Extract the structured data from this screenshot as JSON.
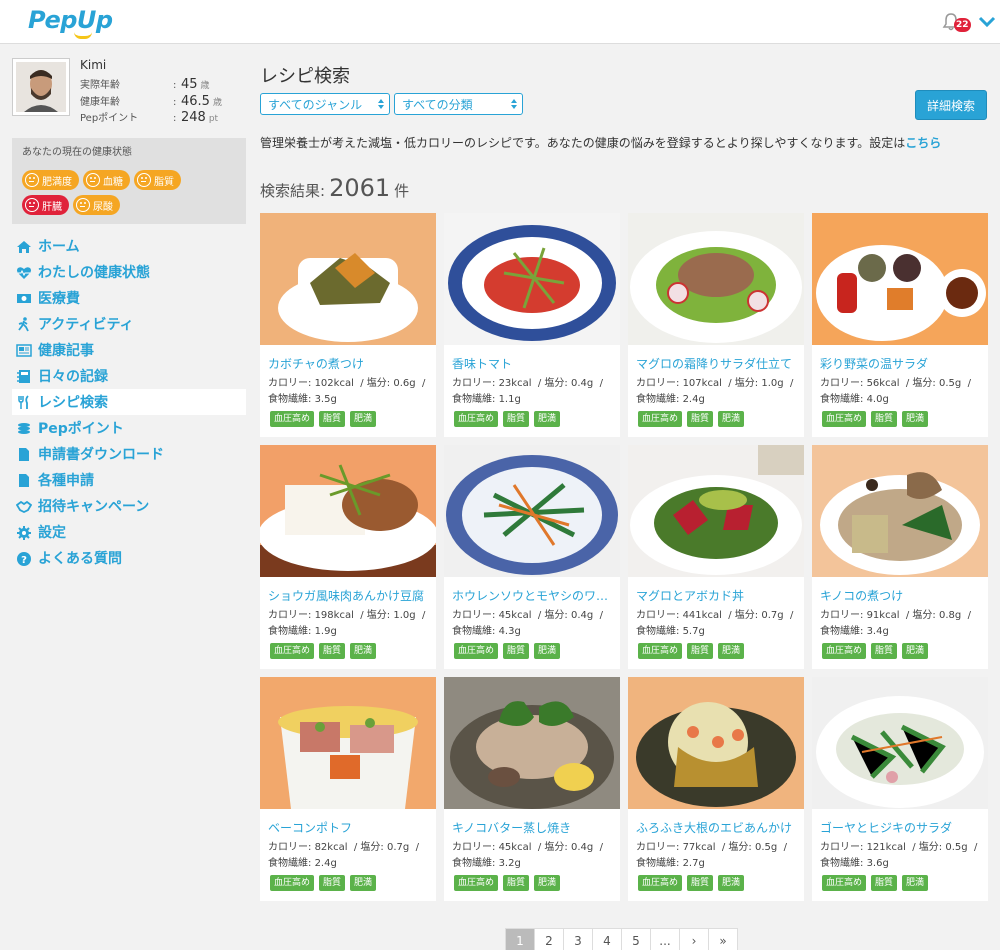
{
  "header": {
    "logo_main": "Pep",
    "logo_up": "Up",
    "notifications": "22"
  },
  "profile": {
    "name": "Kimi",
    "stats": [
      {
        "label": "実際年齢",
        "value": "45",
        "unit": "歳"
      },
      {
        "label": "健康年齢",
        "value": "46.5",
        "unit": "歳"
      },
      {
        "label": "Pepポイント",
        "value": "248",
        "unit": "pt"
      }
    ]
  },
  "health": {
    "title": "あなたの現在の健康状態",
    "badges": [
      {
        "label": "肥満度",
        "color": "#f5a623"
      },
      {
        "label": "血糖",
        "color": "#f5a623"
      },
      {
        "label": "脂質",
        "color": "#f5a623"
      },
      {
        "label": "肝臓",
        "color": "#e0223a"
      },
      {
        "label": "尿酸",
        "color": "#f5a623"
      }
    ]
  },
  "nav": [
    {
      "label": "ホーム",
      "icon": "home-icon"
    },
    {
      "label": "わたしの健康状態",
      "icon": "heart-pulse-icon"
    },
    {
      "label": "医療費",
      "icon": "money-icon"
    },
    {
      "label": "アクティビティ",
      "icon": "walking-icon"
    },
    {
      "label": "健康記事",
      "icon": "newspaper-icon"
    },
    {
      "label": "日々の記録",
      "icon": "notebook-icon"
    },
    {
      "label": "レシピ検索",
      "icon": "fork-knife-icon"
    },
    {
      "label": "Pepポイント",
      "icon": "coins-icon"
    },
    {
      "label": "申請書ダウンロード",
      "icon": "document-icon"
    },
    {
      "label": "各種申請",
      "icon": "file-icon"
    },
    {
      "label": "招待キャンペーン",
      "icon": "handshake-icon"
    },
    {
      "label": "設定",
      "icon": "gear-icon"
    },
    {
      "label": "よくある質問",
      "icon": "question-icon"
    }
  ],
  "main": {
    "title": "レシピ検索",
    "genre_select": "すべてのジャンル",
    "category_select": "すべての分類",
    "advanced_button": "詳細検索",
    "intro": "管理栄養士が考えた減塩・低カロリーのレシピです。あなたの健康の悩みを登録するとより探しやすくなります。設定は",
    "intro_link": "こちら",
    "results_label": "検索結果:",
    "results_count": "2061",
    "results_unit": "件"
  },
  "recipes": [
    {
      "title": "カボチャの煮つけ",
      "calories": "102kcal",
      "salt": "0.6g",
      "fiber": "3.5g"
    },
    {
      "title": "香味トマト",
      "calories": "23kcal",
      "salt": "0.4g",
      "fiber": "1.1g"
    },
    {
      "title": "マグロの霜降りサラダ仕立て",
      "calories": "107kcal",
      "salt": "1.0g",
      "fiber": "2.4g"
    },
    {
      "title": "彩り野菜の温サラダ",
      "calories": "56kcal",
      "salt": "0.5g",
      "fiber": "4.0g"
    },
    {
      "title": "ショウガ風味肉あんかけ豆腐",
      "calories": "198kcal",
      "salt": "1.0g",
      "fiber": "1.9g"
    },
    {
      "title": "ホウレンソウとモヤシのワ…",
      "calories": "45kcal",
      "salt": "0.4g",
      "fiber": "4.3g"
    },
    {
      "title": "マグロとアボカド丼",
      "calories": "441kcal",
      "salt": "0.7g",
      "fiber": "5.7g"
    },
    {
      "title": "キノコの煮つけ",
      "calories": "91kcal",
      "salt": "0.8g",
      "fiber": "3.4g"
    },
    {
      "title": "ベーコンポトフ",
      "calories": "82kcal",
      "salt": "0.7g",
      "fiber": "2.4g"
    },
    {
      "title": "キノコバター蒸し焼き",
      "calories": "45kcal",
      "salt": "0.4g",
      "fiber": "3.2g"
    },
    {
      "title": "ふろふき大根のエビあんかけ",
      "calories": "77kcal",
      "salt": "0.5g",
      "fiber": "2.7g"
    },
    {
      "title": "ゴーヤとヒジキのサラダ",
      "calories": "121kcal",
      "salt": "0.5g",
      "fiber": "3.6g"
    }
  ],
  "labels": {
    "calorie": "カロリー:",
    "salt": "塩分:",
    "fiber": "食物繊維:",
    "tags": [
      "血圧高め",
      "脂質",
      "肥満"
    ]
  },
  "pager": [
    "1",
    "2",
    "3",
    "4",
    "5",
    "...",
    "›",
    "»"
  ],
  "colors": {
    "accent": "#29a3d6",
    "tag": "#5bb24a",
    "warn": "#f5a623",
    "danger": "#e0223a"
  }
}
